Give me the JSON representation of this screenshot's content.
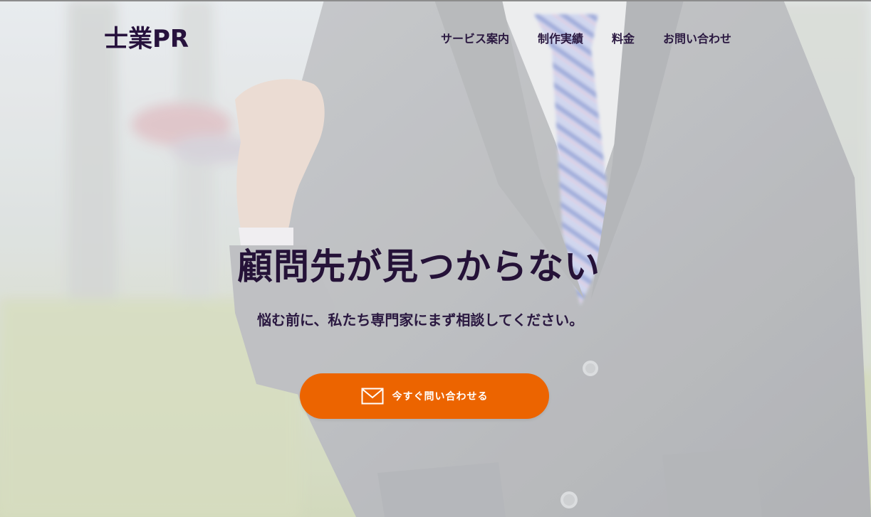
{
  "header": {
    "logo": "士業PR",
    "nav": [
      {
        "label": "サービス案内"
      },
      {
        "label": "制作実績"
      },
      {
        "label": "料金"
      },
      {
        "label": "お問い合わせ"
      }
    ]
  },
  "hero": {
    "headline": "顧問先が見つからない",
    "subline": "悩む前に、私たち専門家にまず相談してください。",
    "cta_label": "今すぐ問い合わせる",
    "cta_icon": "mail-icon"
  },
  "colors": {
    "brand_text": "#27123d",
    "cta_background": "#ec6400",
    "cta_text": "#ffffff"
  }
}
